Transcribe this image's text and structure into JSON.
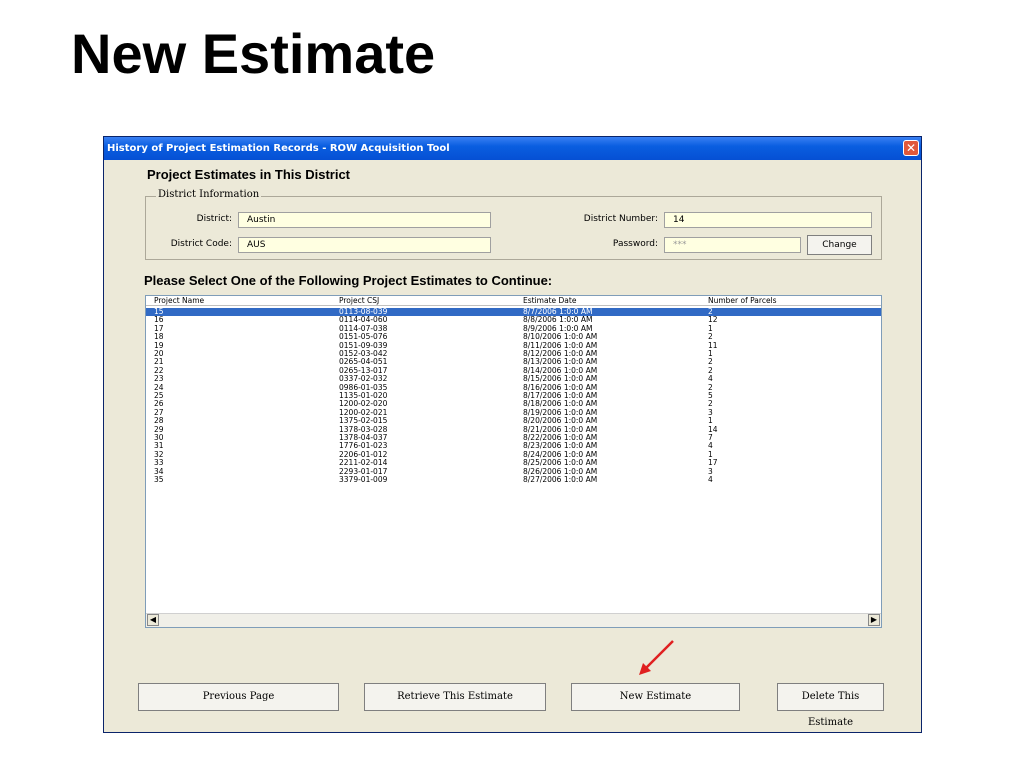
{
  "slide": {
    "title": "New Estimate"
  },
  "window": {
    "title": "History of Project Estimation Records - ROW Acquisition Tool",
    "close_glyph": "✕"
  },
  "section_title": "Project Estimates in This District",
  "district_info": {
    "legend": "District Information",
    "district_label": "District:",
    "district_value": "Austin",
    "district_number_label": "District Number:",
    "district_number_value": "14",
    "district_code_label": "District Code:",
    "district_code_value": "AUS",
    "password_label": "Password:",
    "password_value": "***",
    "change_button": "Change"
  },
  "list_title": "Please Select One of the Following Project Estimates to Continue:",
  "table": {
    "columns": [
      "Project Name",
      "Project CSJ",
      "Estimate Date",
      "Number of Parcels"
    ],
    "selected_index": 0,
    "rows": [
      [
        "15",
        "0113-08-039",
        "8/7/2006  1:0:0 AM",
        "2"
      ],
      [
        "16",
        "0114-04-060",
        "8/8/2006  1:0:0 AM",
        "12"
      ],
      [
        "17",
        "0114-07-038",
        "8/9/2006  1:0:0 AM",
        "1"
      ],
      [
        "18",
        "0151-05-076",
        "8/10/2006  1:0:0 AM",
        "2"
      ],
      [
        "19",
        "0151-09-039",
        "8/11/2006  1:0:0 AM",
        "11"
      ],
      [
        "20",
        "0152-03-042",
        "8/12/2006  1:0:0 AM",
        "1"
      ],
      [
        "21",
        "0265-04-051",
        "8/13/2006  1:0:0 AM",
        "2"
      ],
      [
        "22",
        "0265-13-017",
        "8/14/2006  1:0:0 AM",
        "2"
      ],
      [
        "23",
        "0337-02-032",
        "8/15/2006  1:0:0 AM",
        "4"
      ],
      [
        "24",
        "0986-01-035",
        "8/16/2006  1:0:0 AM",
        "2"
      ],
      [
        "25",
        "1135-01-020",
        "8/17/2006  1:0:0 AM",
        "5"
      ],
      [
        "26",
        "1200-02-020",
        "8/18/2006  1:0:0 AM",
        "2"
      ],
      [
        "27",
        "1200-02-021",
        "8/19/2006  1:0:0 AM",
        "3"
      ],
      [
        "28",
        "1375-02-015",
        "8/20/2006  1:0:0 AM",
        "1"
      ],
      [
        "29",
        "1378-03-028",
        "8/21/2006  1:0:0 AM",
        "14"
      ],
      [
        "30",
        "1378-04-037",
        "8/22/2006  1:0:0 AM",
        "7"
      ],
      [
        "31",
        "1776-01-023",
        "8/23/2006  1:0:0 AM",
        "4"
      ],
      [
        "32",
        "2206-01-012",
        "8/24/2006  1:0:0 AM",
        "1"
      ],
      [
        "33",
        "2211-02-014",
        "8/25/2006  1:0:0 AM",
        "17"
      ],
      [
        "34",
        "2293-01-017",
        "8/26/2006  1:0:0 AM",
        "3"
      ],
      [
        "35",
        "3379-01-009",
        "8/27/2006  1:0:0 AM",
        "4"
      ]
    ]
  },
  "scrollbar": {
    "left_glyph": "◀",
    "right_glyph": "▶"
  },
  "buttons": {
    "previous_page": "Previous Page",
    "retrieve": "Retrieve This Estimate",
    "new_estimate": "New Estimate",
    "delete": "Delete This Estimate"
  },
  "colors": {
    "titlebar": "#0a5ee0",
    "selection": "#316ac5",
    "field_bg": "#ffffe1",
    "window_bg": "#ece9d8",
    "annotation_arrow": "#e02020"
  }
}
